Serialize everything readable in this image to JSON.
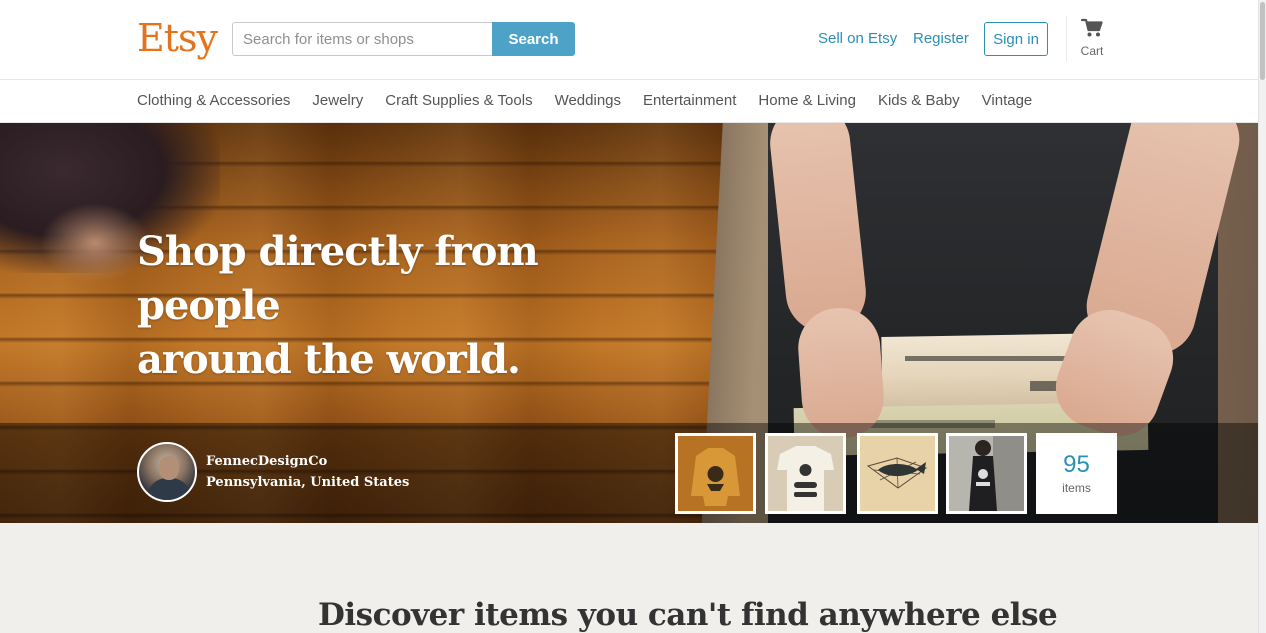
{
  "header": {
    "logo": "Etsy",
    "search_placeholder": "Search for items or shops",
    "search_button": "Search",
    "sell_link": "Sell on Etsy",
    "register_link": "Register",
    "signin_button": "Sign in",
    "cart_label": "Cart"
  },
  "categories": [
    "Clothing & Accessories",
    "Jewelry",
    "Craft Supplies & Tools",
    "Weddings",
    "Entertainment",
    "Home & Living",
    "Kids & Baby",
    "Vintage"
  ],
  "hero": {
    "headline_line1": "Shop directly from people",
    "headline_line2": "around the world.",
    "shop": {
      "name": "FennecDesignCo",
      "location": "Pennsylvania, United States",
      "item_count": "95",
      "item_count_label": "items",
      "thumbnail_icons": [
        "orange-sweater-image",
        "white-tee-image",
        "whale-print-image",
        "black-tank-image"
      ]
    }
  },
  "discover": {
    "title": "Discover items you can't find anywhere else"
  },
  "colors": {
    "brand_orange": "#e5731c",
    "link_blue": "#2c8fb5",
    "search_button": "#4da3c7",
    "section_bg": "#f0efeb"
  }
}
